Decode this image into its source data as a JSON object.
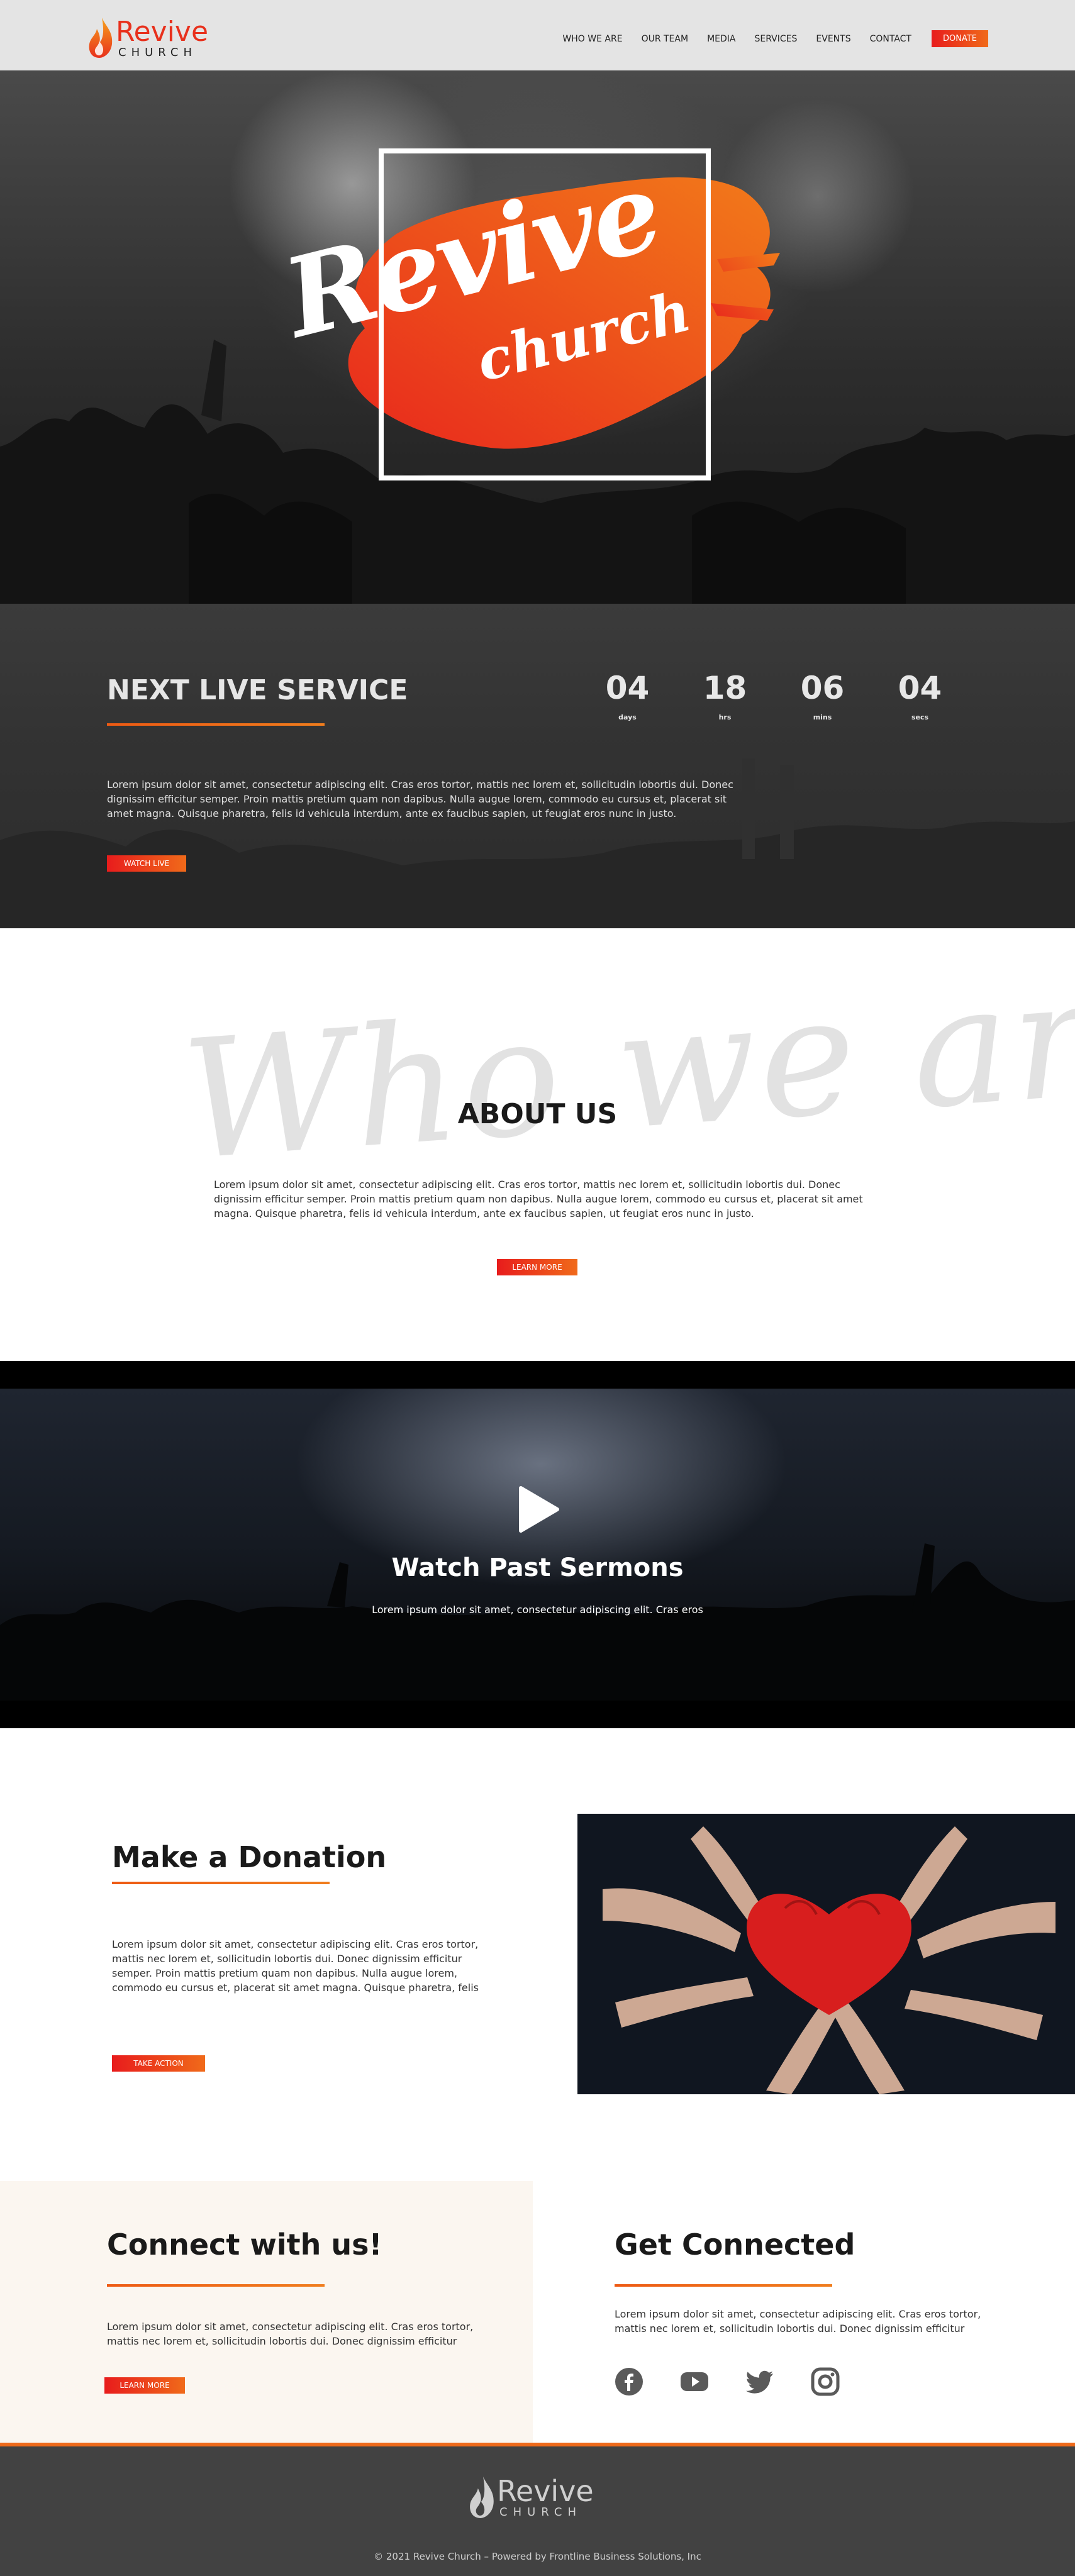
{
  "brand": {
    "name": "Revive",
    "sub": "CHURCH",
    "accent": "#e8301c",
    "orange": "#f06a1a"
  },
  "nav": {
    "items": [
      "WHO WE ARE",
      "OUR TEAM",
      "MEDIA",
      "SERVICES",
      "EVENTS",
      "CONTACT"
    ],
    "donate": "DONATE"
  },
  "hero": {
    "word1": "Revive",
    "word2": "church"
  },
  "live": {
    "title": "NEXT LIVE SERVICE",
    "countdown": [
      {
        "value": "04",
        "label": "days"
      },
      {
        "value": "18",
        "label": "hrs"
      },
      {
        "value": "06",
        "label": "mins"
      },
      {
        "value": "04",
        "label": "secs"
      }
    ],
    "body": "Lorem ipsum dolor sit amet, consectetur adipiscing elit. Cras eros tortor, mattis nec lorem et, sollicitudin lobortis dui. Donec dignissim efficitur semper. Proin mattis pretium quam non dapibus. Nulla augue lorem, commodo eu cursus et, placerat sit amet magna. Quisque pharetra, felis id vehicula interdum, ante ex faucibus sapien, ut feugiat eros nunc in justo.",
    "button": "WATCH LIVE"
  },
  "about": {
    "script": "Who we are",
    "title": "ABOUT US",
    "body": "Lorem ipsum dolor sit amet, consectetur adipiscing elit. Cras eros tortor, mattis nec lorem et, sollicitudin lobortis dui. Donec dignissim efficitur semper. Proin mattis pretium quam non dapibus. Nulla augue lorem, commodo eu cursus et, placerat sit amet magna. Quisque pharetra, felis id vehicula interdum, ante ex faucibus sapien, ut feugiat eros nunc in justo.",
    "button": "LEARN MORE"
  },
  "sermons": {
    "title": "Watch Past Sermons",
    "subtitle": "Lorem ipsum dolor sit amet, consectetur adipiscing elit. Cras eros"
  },
  "donation": {
    "title": "Make a Donation",
    "body": "Lorem ipsum dolor sit amet, consectetur adipiscing elit. Cras eros tortor, mattis nec lorem et, sollicitudin lobortis dui. Donec dignissim efficitur semper. Proin mattis pretium quam non dapibus. Nulla augue lorem, commodo eu cursus et, placerat sit amet magna. Quisque pharetra, felis",
    "button": "TAKE ACTION"
  },
  "connect": {
    "title": "Connect with us!",
    "body": "Lorem ipsum dolor sit amet, consectetur adipiscing elit. Cras eros tortor, mattis nec lorem et, sollicitudin lobortis dui. Donec dignissim efficitur",
    "button": "LEARN MORE"
  },
  "getconnected": {
    "title": "Get Connected",
    "body": "Lorem ipsum dolor sit amet, consectetur adipiscing elit. Cras eros tortor, mattis nec lorem et, sollicitudin lobortis dui. Donec dignissim efficitur",
    "socials": [
      "facebook-icon",
      "youtube-icon",
      "twitter-icon",
      "instagram-icon"
    ]
  },
  "footer": {
    "logo_name": "Revive",
    "logo_sub": "CHURCH",
    "copyright": "© 2021 Revive Church  – Powered by Frontline Business Solutions, Inc"
  }
}
